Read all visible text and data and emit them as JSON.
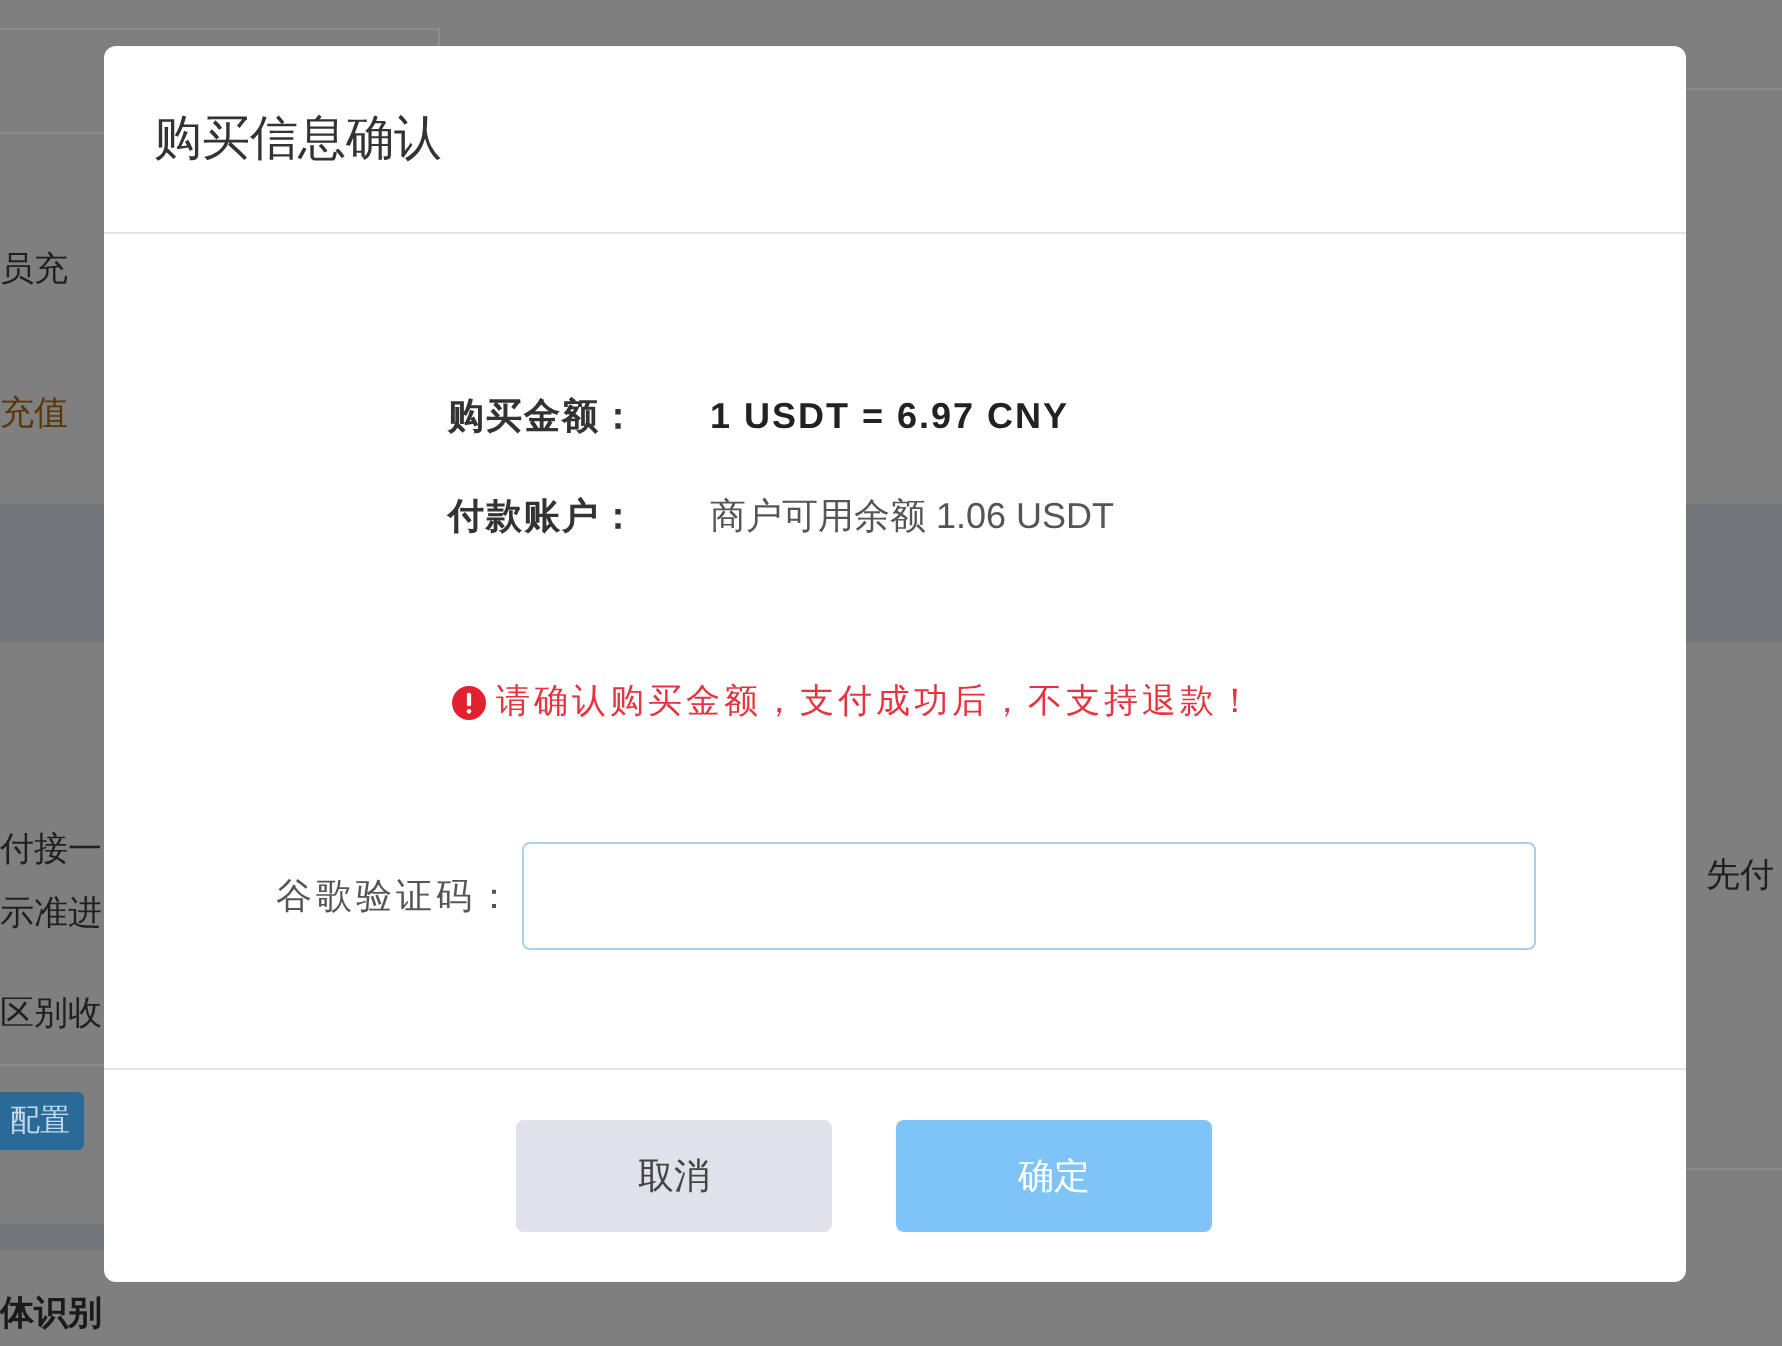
{
  "background": {
    "left": [
      {
        "kind": "text",
        "text": "员充"
      },
      {
        "kind": "link",
        "text": "充值"
      },
      {
        "kind": "text",
        "text": "付接一"
      },
      {
        "kind": "text",
        "text": "示准进"
      },
      {
        "kind": "text",
        "text": "区别收"
      },
      {
        "kind": "button",
        "text": "配置"
      }
    ],
    "right": [
      {
        "kind": "text",
        "text": "先付"
      }
    ],
    "bottom": [
      {
        "kind": "heading",
        "text": "体识别"
      }
    ]
  },
  "dialog": {
    "title": "购买信息确认",
    "details": [
      {
        "label": "购买金额：",
        "value": "1 USDT = 6.97 CNY",
        "emphasis": true
      },
      {
        "label": "付款账户：",
        "value": "商户可用余额 1.06 USDT",
        "emphasis": false
      }
    ],
    "warning": "请确认购买金额，支付成功后，不支持退款！",
    "field": {
      "label": "谷歌验证码："
    },
    "buttons": [
      {
        "label": "取消",
        "kind": "secondary",
        "disabled": false
      },
      {
        "label": "确定",
        "kind": "primary",
        "disabled": true
      }
    ]
  }
}
